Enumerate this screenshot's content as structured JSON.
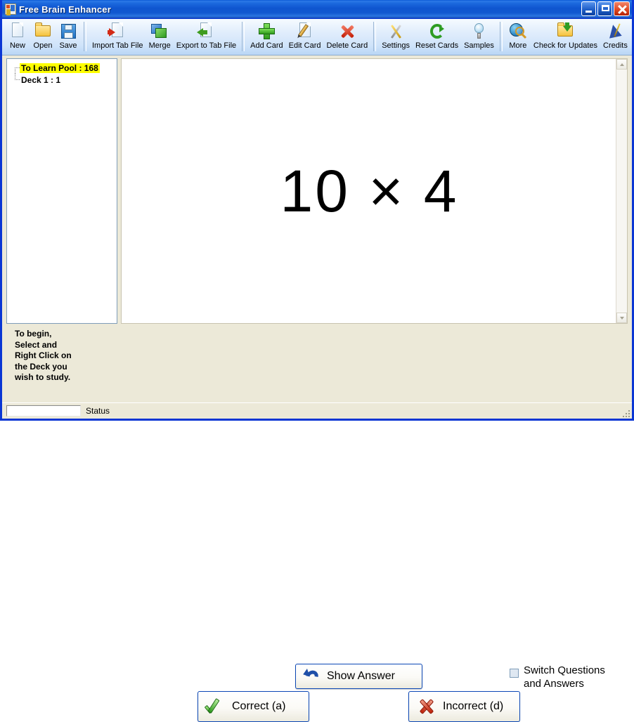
{
  "window": {
    "title": "Free Brain Enhancer",
    "icon": "app-icon",
    "controls": {
      "minimize": "Minimize",
      "maximize": "Maximize",
      "close": "Close"
    }
  },
  "toolbar": {
    "groups": [
      {
        "items": [
          {
            "label": "New",
            "icon": "new-page-icon"
          },
          {
            "label": "Open",
            "icon": "open-folder-icon"
          },
          {
            "label": "Save",
            "icon": "save-floppy-icon"
          }
        ]
      },
      {
        "items": [
          {
            "label": "Import Tab File",
            "icon": "import-arrow-icon"
          },
          {
            "label": "Merge",
            "icon": "merge-squares-icon"
          },
          {
            "label": "Export to Tab File",
            "icon": "export-arrow-icon"
          }
        ]
      },
      {
        "items": [
          {
            "label": "Add Card",
            "icon": "green-plus-icon"
          },
          {
            "label": "Edit Card",
            "icon": "edit-pencil-icon"
          },
          {
            "label": "Delete Card",
            "icon": "red-x-icon"
          }
        ]
      },
      {
        "items": [
          {
            "label": "Settings",
            "icon": "tools-icon"
          },
          {
            "label": "Reset Cards",
            "icon": "refresh-icon"
          },
          {
            "label": "Samples",
            "icon": "lightbulb-icon"
          }
        ]
      },
      {
        "items": [
          {
            "label": "More",
            "icon": "globe-search-icon"
          },
          {
            "label": "Check for Updates",
            "icon": "folder-download-icon"
          },
          {
            "label": "Credits",
            "icon": "wizard-hat-icon"
          }
        ]
      }
    ]
  },
  "tree": {
    "nodes": [
      {
        "label": "To Learn Pool : 168",
        "selected": true
      },
      {
        "label": "Deck 1 : 1",
        "selected": false
      }
    ]
  },
  "card": {
    "text": "10 × 4"
  },
  "scrollbar": {
    "up": "scroll-up",
    "down": "scroll-down"
  },
  "bottom": {
    "hint": "To begin,\nSelect and\nRight Click on\nthe Deck you\nwish to study.",
    "show_answer_label": "Show Answer",
    "correct_label": "Correct (a)",
    "incorrect_label": "Incorrect (d)",
    "switch_label": "Switch Questions\nand Answers",
    "switch_checked": false
  },
  "statusbar": {
    "status_text": "Status",
    "progress_value": ""
  },
  "colors": {
    "titlebar_blue": "#0f55cf",
    "window_border": "#0a36d4",
    "face": "#ece9d8",
    "selection_yellow": "#ffff00",
    "button_border": "#0a46b4"
  }
}
